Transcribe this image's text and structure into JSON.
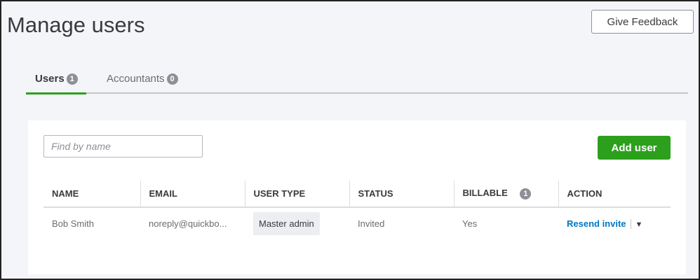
{
  "header": {
    "title": "Manage users",
    "feedback": "Give Feedback"
  },
  "tabs": [
    {
      "label": "Users",
      "count": "1"
    },
    {
      "label": "Accountants",
      "count": "0"
    }
  ],
  "search": {
    "placeholder": "Find by name"
  },
  "add_user": "Add user",
  "table": {
    "headers": [
      "NAME",
      "EMAIL",
      "USER TYPE",
      "STATUS",
      "BILLABLE",
      "ACTION"
    ],
    "billable_count": "1",
    "rows": [
      {
        "name": "Bob Smith",
        "email": "noreply@quickbo...",
        "type": "Master admin",
        "status": "Invited",
        "billable": "Yes",
        "action": "Resend invite"
      }
    ]
  },
  "colors": {
    "accent": "#2ca01c",
    "link": "#0077c5"
  }
}
